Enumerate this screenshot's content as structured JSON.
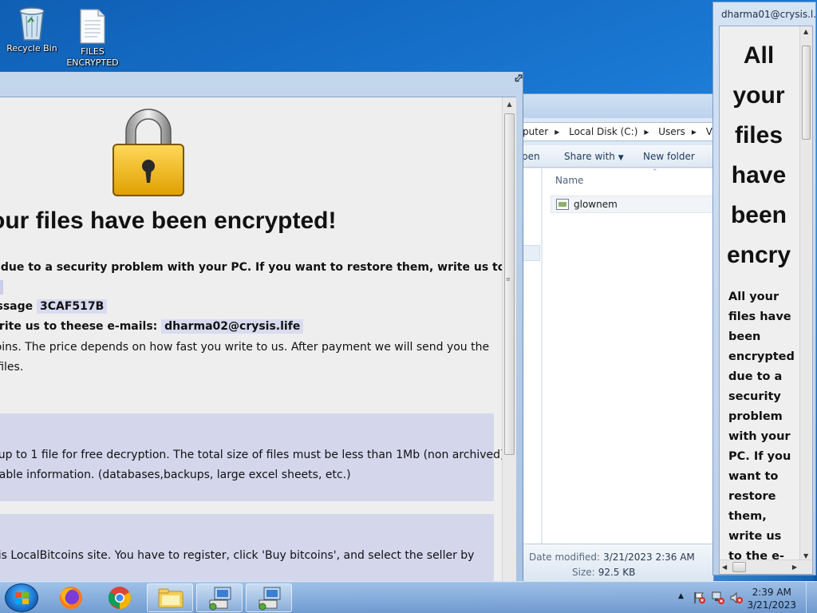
{
  "desktop": {
    "icons": [
      {
        "label": "Recycle Bin"
      },
      {
        "label": "FILES ENCRYPTED"
      }
    ]
  },
  "ransom_window": {
    "headline": "our files have been encrypted!",
    "line1": "d due to a security problem with your PC. If you want to restore them, write us to",
    "line3_prefix": "essage",
    "id_code": "3CAF517B",
    "line4_prefix": "write us to theese e-mails:",
    "email": "dharma02@crysis.life",
    "line5": "coins. The price depends on how fast you write to us. After payment we will send you the",
    "line6": "r files.",
    "box1_line1": "s up to 1 file for free decryption. The total size of files must be less than 1Mb (non archived),",
    "box1_line2": "luable information. (databases,backups, large excel sheets, etc.)",
    "box2_line1": "s is LocalBitcoins site. You have to register, click 'Buy bitcoins', and select the seller by",
    "box2_link": "bitcoins"
  },
  "explorer": {
    "address": [
      "puter",
      "Local Disk (C:)",
      "Users",
      "VM1"
    ],
    "address_separators": "▸",
    "toolbar": {
      "open_label": "pen",
      "share_label": "Share with",
      "new_folder_label": "New folder"
    },
    "column_name": "Name",
    "files": [
      {
        "name": "glownem"
      }
    ],
    "details": {
      "modified_label": "Date modified:",
      "modified_value": "3/21/2023 2:36 AM",
      "extra": "D",
      "size_label": "Size:",
      "size_value": "92.5 KB"
    }
  },
  "side_window": {
    "title": "dharma01@crysis.l...",
    "big_text": [
      "All",
      "your",
      "files",
      "have",
      "been",
      "encry"
    ],
    "small_text": [
      "All your",
      "files have",
      "been",
      "encrypted",
      "due to a",
      "security",
      "problem",
      "with your",
      "PC. If you",
      "want to",
      "restore",
      "them,",
      "write us",
      "to the e-"
    ]
  },
  "taskbar": {
    "apps": [
      "firefox",
      "chrome",
      "file-explorer",
      "network-app-1",
      "network-app-2"
    ],
    "clock_time": "2:39 AM",
    "clock_date": "3/21/2023"
  }
}
